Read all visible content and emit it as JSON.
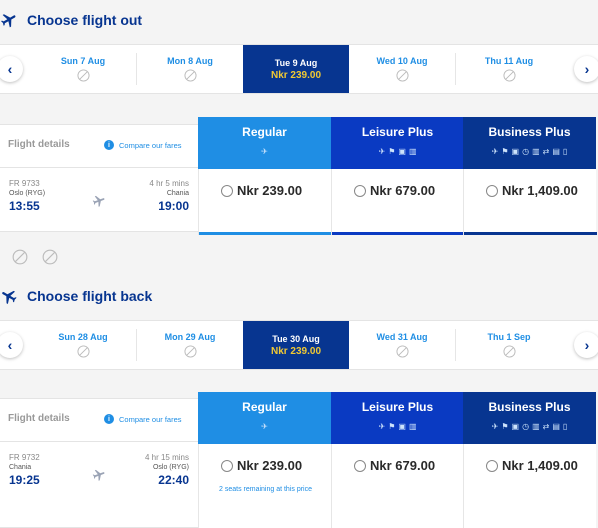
{
  "outbound": {
    "title": "Choose flight out",
    "dates": [
      {
        "label": "Sun 7 Aug",
        "price": null
      },
      {
        "label": "Mon 8 Aug",
        "price": null
      },
      {
        "label": "Tue 9 Aug",
        "price": "Nkr 239.00"
      },
      {
        "label": "Wed 10 Aug",
        "price": null
      },
      {
        "label": "Thu 11 Aug",
        "price": null
      }
    ],
    "details_label": "Flight details",
    "compare_label": "Compare our fares",
    "fares": [
      {
        "name": "Regular",
        "icons": [
          "plane-icon"
        ]
      },
      {
        "name": "Leisure Plus",
        "icons": [
          "plane-icon",
          "priority-icon",
          "bag-icon",
          "seat-icon"
        ]
      },
      {
        "name": "Business Plus",
        "icons": [
          "plane-icon",
          "priority-icon",
          "bag-icon",
          "clock-icon",
          "seat-icon",
          "flex-icon",
          "checkin-icon",
          "phone-icon"
        ]
      }
    ],
    "flight": {
      "number": "FR 9733",
      "from": "Oslo (RYG)",
      "departure": "13:55",
      "duration": "4 hr 5 mins",
      "to": "Chania",
      "arrival": "19:00"
    },
    "prices": [
      "Nkr 239.00",
      "Nkr 679.00",
      "Nkr 1,409.00"
    ]
  },
  "return": {
    "title": "Choose flight back",
    "dates": [
      {
        "label": "Sun 28 Aug",
        "price": null
      },
      {
        "label": "Mon 29 Aug",
        "price": null
      },
      {
        "label": "Tue 30 Aug",
        "price": "Nkr 239.00"
      },
      {
        "label": "Wed 31 Aug",
        "price": null
      },
      {
        "label": "Thu 1 Sep",
        "price": null
      }
    ],
    "details_label": "Flight details",
    "compare_label": "Compare our fares",
    "fares": [
      {
        "name": "Regular"
      },
      {
        "name": "Leisure Plus"
      },
      {
        "name": "Business Plus"
      }
    ],
    "flight": {
      "number": "FR 9732",
      "from": "Chania",
      "departure": "19:25",
      "duration": "4 hr 15 mins",
      "to": "Oslo (RYG)",
      "arrival": "22:40"
    },
    "prices": [
      "Nkr 239.00",
      "Nkr 679.00",
      "Nkr 1,409.00"
    ],
    "regular_note": "2 seats remaining at this price"
  },
  "colors": {
    "brand_dark": "#073590",
    "brand_mid": "#0a3ac2",
    "brand_light": "#1f8ee4",
    "price_highlight": "#f1c933"
  },
  "icons": {
    "prev": "chevron-left-icon",
    "next": "chevron-right-icon",
    "no_flight": "no-flight-icon",
    "info": "info-icon"
  }
}
